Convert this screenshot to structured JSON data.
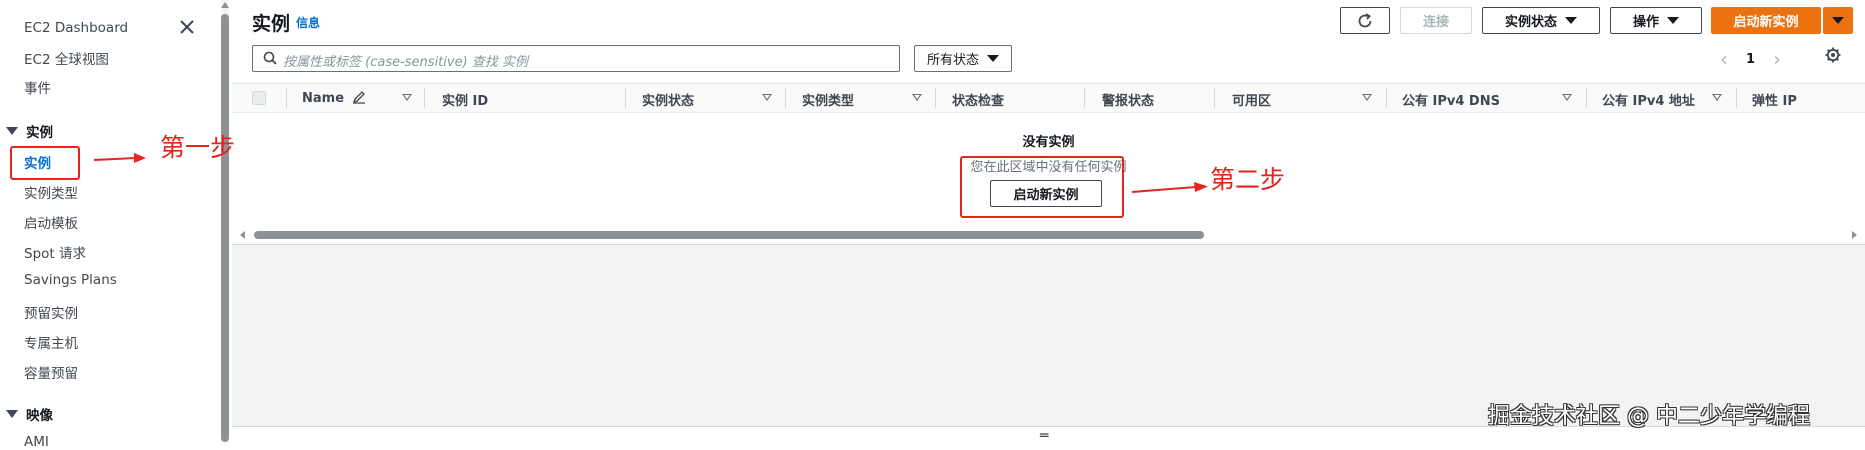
{
  "sidebar": {
    "top_items": [
      {
        "label": "EC2 Dashboard"
      },
      {
        "label": "EC2 全球视图"
      },
      {
        "label": "事件"
      }
    ],
    "sections": [
      {
        "title": "实例",
        "items": [
          {
            "label": "实例",
            "active": true
          },
          {
            "label": "实例类型"
          },
          {
            "label": "启动模板"
          },
          {
            "label": "Spot 请求"
          },
          {
            "label": "Savings Plans"
          },
          {
            "label": "预留实例"
          },
          {
            "label": "专属主机"
          },
          {
            "label": "容量预留"
          }
        ]
      },
      {
        "title": "映像",
        "items": [
          {
            "label": "AMI"
          }
        ]
      }
    ]
  },
  "header": {
    "title": "实例",
    "info_link": "信息",
    "refresh_icon": "refresh-icon",
    "connect_label": "连接",
    "instance_state_label": "实例状态",
    "actions_label": "操作",
    "launch_label": "启动新实例"
  },
  "filter": {
    "search_placeholder": "按属性或标签 (case-sensitive) 查找 实例",
    "state_filter": "所有状态"
  },
  "pagination": {
    "page": "1"
  },
  "table": {
    "columns": [
      {
        "label": "Name",
        "editable": true,
        "sortable": true
      },
      {
        "label": "实例 ID",
        "sortable": false
      },
      {
        "label": "实例状态",
        "sortable": true
      },
      {
        "label": "实例类型",
        "sortable": true
      },
      {
        "label": "状态检查",
        "sortable": false
      },
      {
        "label": "警报状态",
        "sortable": false
      },
      {
        "label": "可用区",
        "sortable": true
      },
      {
        "label": "公有 IPv4 DNS",
        "sortable": true
      },
      {
        "label": "公有 IPv4 地址",
        "sortable": true
      },
      {
        "label": "弹性 IP",
        "sortable": false
      }
    ],
    "rows": []
  },
  "empty_state": {
    "title": "没有实例",
    "description": "您在此区域中没有任何实例",
    "button": "启动新实例"
  },
  "annotations": {
    "step1": "第一步",
    "step2": "第二步",
    "color": "#e5241c"
  },
  "watermark": "掘金技术社区 @ 中二少年学编程",
  "colors": {
    "accent": "#ec7211",
    "link": "#0972d3",
    "annotation": "#e5241c"
  }
}
